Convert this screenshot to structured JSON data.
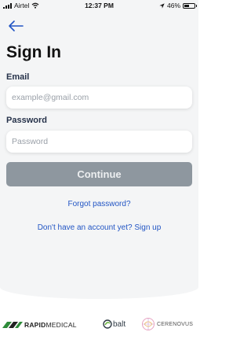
{
  "status_bar": {
    "carrier": "Airtel",
    "time": "12:37 PM",
    "battery": "46%",
    "battery_level": 0.46
  },
  "header": {
    "title": "Sign In"
  },
  "form": {
    "email_label": "Email",
    "email_placeholder": "example@gmail.com",
    "email_value": "",
    "password_label": "Password",
    "password_placeholder": "Password",
    "password_value": "",
    "continue_label": "Continue"
  },
  "links": {
    "forgot_password": "Forgot password?",
    "signup": "Don't have an account yet? Sign up"
  },
  "partners": [
    {
      "name_bold": "RAPID",
      "name_rest": "MEDICAL"
    },
    {
      "name": "balt"
    },
    {
      "name": "CERENOVUS"
    }
  ],
  "colors": {
    "link": "#2255c4",
    "button_bg": "#8e979f",
    "button_text": "#eceef0",
    "label": "#26324a",
    "background_top": "#f4f5f6"
  },
  "icons": [
    "signal-icon",
    "wifi-icon",
    "location-arrow-icon",
    "battery-icon",
    "back-arrow-icon"
  ]
}
